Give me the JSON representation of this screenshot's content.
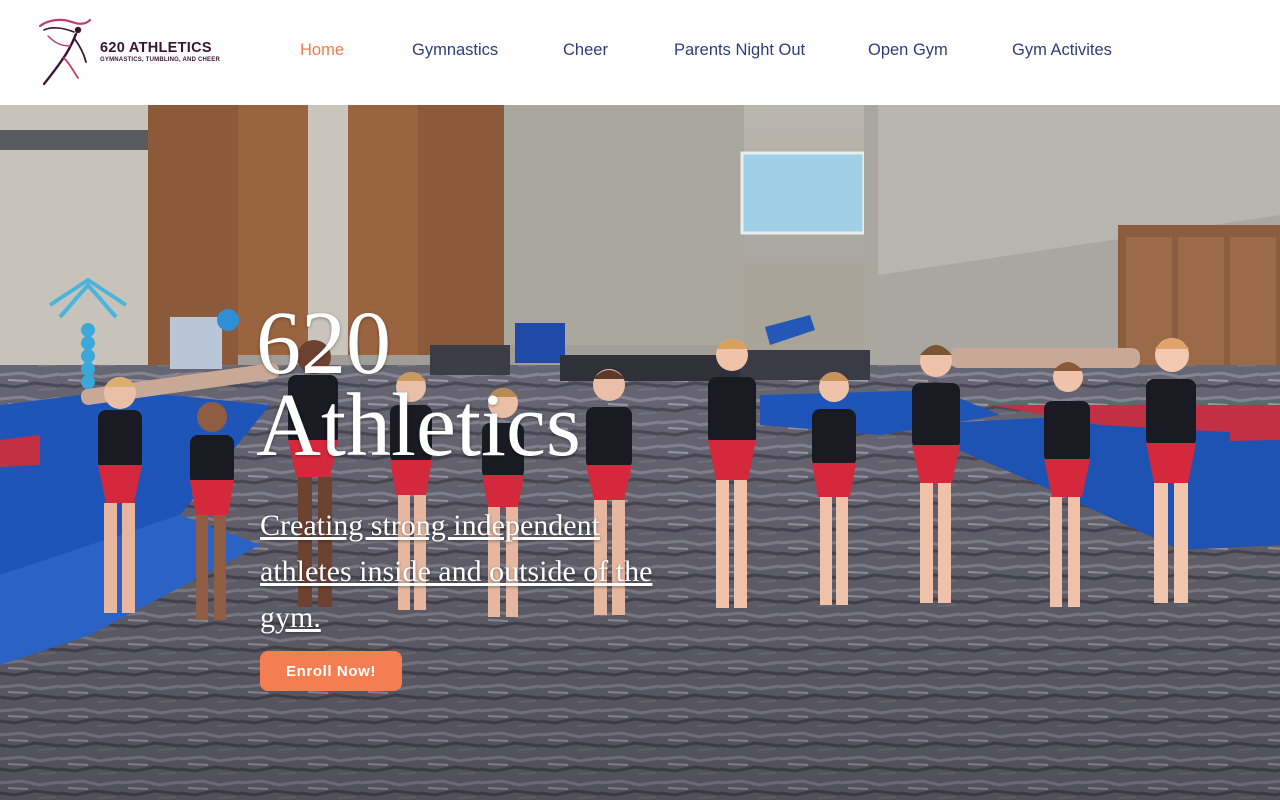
{
  "brand": {
    "name": "620 ATHLETICS",
    "tagline": "GYMNASTICS, TUMBLING, AND CHEER",
    "logo_icon": "gymnast-silhouette-icon",
    "color": "#3a1532"
  },
  "nav": {
    "items": [
      {
        "label": "Home",
        "active": true
      },
      {
        "label": "Gymnastics",
        "active": false
      },
      {
        "label": "Cheer",
        "active": false
      },
      {
        "label": "Parents Night Out",
        "active": false
      },
      {
        "label": "Open Gym",
        "active": false
      },
      {
        "label": "Gym Activites",
        "active": false
      }
    ],
    "active_color": "#f27a4d",
    "color": "#2e3d7a"
  },
  "hero": {
    "title_line1": "620",
    "title_line2": "Athletics",
    "subtitle": "Creating strong independent athletes inside and outside of the gym.",
    "cta_label": "Enroll Now!",
    "cta_color": "#f47d52",
    "image": "group-of-gymnasts-in-leotards-holding-hands"
  }
}
